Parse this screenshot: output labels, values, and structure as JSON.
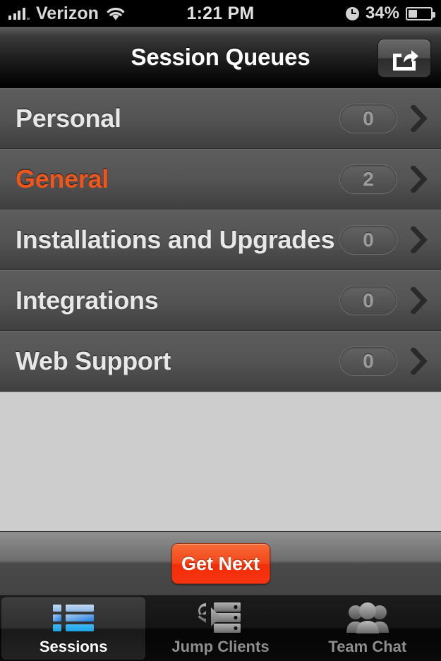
{
  "status_bar": {
    "carrier": "Verizon",
    "time": "1:21 PM",
    "battery_percent": "34%",
    "signal_icon": "signal-bars-icon",
    "wifi_icon": "wifi-icon",
    "alarm_icon": "alarm-clock-icon",
    "battery_icon": "battery-icon",
    "battery_level": 34
  },
  "nav_bar": {
    "title": "Session Queues",
    "share_icon": "share-export-icon"
  },
  "queues": {
    "rows": [
      {
        "label": "Personal",
        "count": "0",
        "active": false
      },
      {
        "label": "General",
        "count": "2",
        "active": true
      },
      {
        "label": "Installations and Upgrades",
        "count": "0",
        "active": false
      },
      {
        "label": "Integrations",
        "count": "0",
        "active": false
      },
      {
        "label": "Web Support",
        "count": "0",
        "active": false
      }
    ]
  },
  "toolbar": {
    "get_next_label": "Get Next"
  },
  "tab_bar": {
    "tabs": [
      {
        "label": "Sessions",
        "icon": "sessions-list-icon",
        "selected": true
      },
      {
        "label": "Jump Clients",
        "icon": "server-jump-icon",
        "selected": false
      },
      {
        "label": "Team Chat",
        "icon": "people-group-icon",
        "selected": false
      }
    ]
  },
  "colors": {
    "accent_orange": "#f0551a",
    "button_red": "#f4461a",
    "row_gray": "#545454",
    "filler_gray": "#cdcdcd"
  }
}
